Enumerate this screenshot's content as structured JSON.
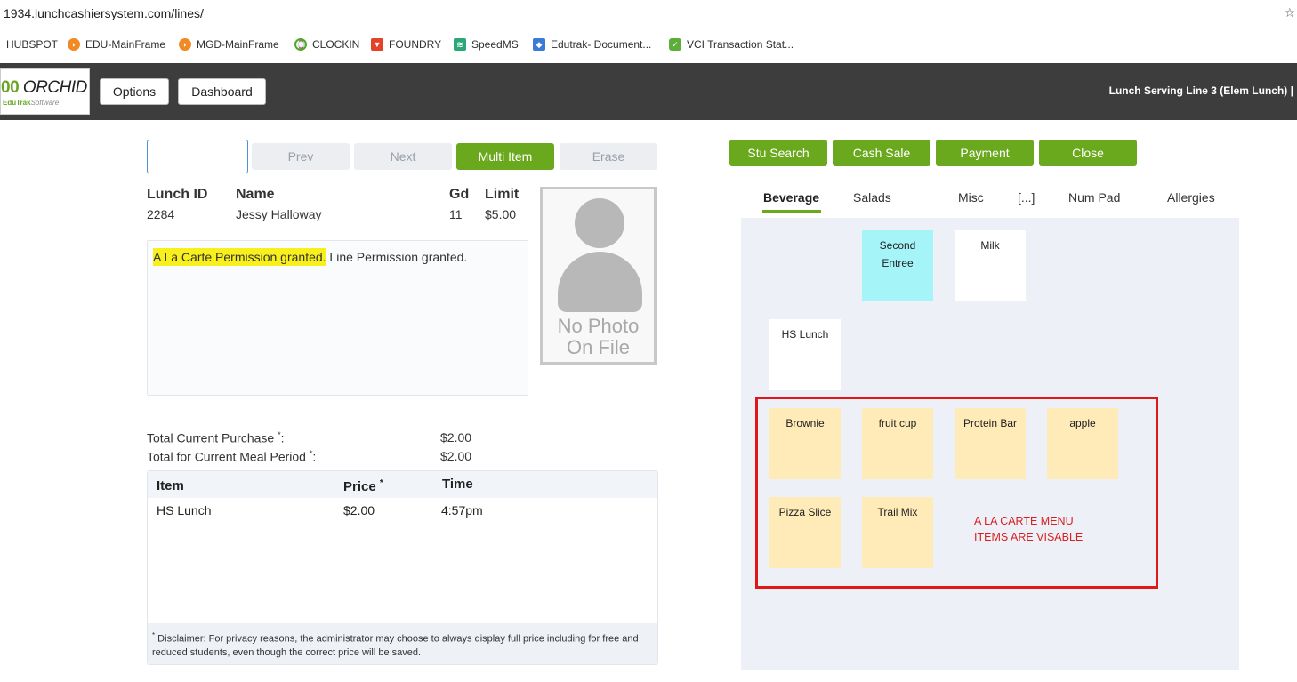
{
  "browser": {
    "url": "1934.lunchcashiersystem.com/lines/",
    "bookmarks": [
      {
        "label": "HUBSPOT",
        "icon": "hubspot-icon"
      },
      {
        "label": "EDU-MainFrame",
        "icon": "mainframe-icon"
      },
      {
        "label": "MGD-MainFrame",
        "icon": "mainframe-icon"
      },
      {
        "label": "CLOCKIN",
        "icon": "clock-icon"
      },
      {
        "label": "FOUNDRY",
        "icon": "gitlab-icon"
      },
      {
        "label": "SpeedMS",
        "icon": "speedms-icon"
      },
      {
        "label": "Edutrak- Document...",
        "icon": "docs-icon"
      },
      {
        "label": "VCI Transaction Stat...",
        "icon": "vci-icon"
      }
    ]
  },
  "header": {
    "logo_text": "ORCHID",
    "logo_prefix": "00",
    "logo_sub_brand": "EduTrak",
    "logo_sub_software": "Software",
    "options_label": "Options",
    "dashboard_label": "Dashboard",
    "line_title": "Lunch Serving Line 3 (Elem Lunch) |"
  },
  "controls": {
    "lunch_input_value": "",
    "prev_label": "Prev",
    "next_label": "Next",
    "multi_item_label": "Multi Item",
    "erase_label": "Erase"
  },
  "student": {
    "lunch_id_header": "Lunch ID",
    "name_header": "Name",
    "grade_header": "Gd",
    "limit_header": "Limit",
    "lunch_id": "2284",
    "name": "Jessy Halloway",
    "grade": "11",
    "limit": "$5.00",
    "photo_line1": "No Photo",
    "photo_line2": "On File"
  },
  "messages": {
    "highlighted": "A La Carte Permission granted.",
    "rest": " Line Permission granted."
  },
  "totals": {
    "current_purchase_label": "Total Current Purchase",
    "current_purchase_value": "$2.00",
    "meal_period_label": "Total for Current Meal Period",
    "meal_period_value": "$2.00",
    "asterisk": "*",
    "colon": ":"
  },
  "items_table": {
    "columns": [
      "Item",
      "Price",
      "Time"
    ],
    "price_asterisk": "*",
    "rows": [
      {
        "item": "HS Lunch",
        "price": "$2.00",
        "time": "4:57pm"
      }
    ],
    "disclaimer_asterisk": "*",
    "disclaimer": " Disclaimer: For privacy reasons, the administrator may choose to always display full price including for free and reduced students, even though the correct price will be saved."
  },
  "actions": {
    "stu_search_label": "Stu Search",
    "cash_sale_label": "Cash Sale",
    "payment_label": "Payment",
    "close_label": "Close"
  },
  "tabs": [
    "Beverage",
    "Salads",
    "Misc",
    "[...]",
    "Num Pad",
    "Allergies"
  ],
  "menu_tiles": {
    "second_entree_line1": "Second",
    "second_entree_line2": "Entree",
    "milk": "Milk",
    "hs_lunch": "HS Lunch",
    "brownie": "Brownie",
    "fruit_cup": "fruit cup",
    "protein_bar": "Protein Bar",
    "apple": "apple",
    "pizza_slice": "Pizza Slice",
    "trail_mix": "Trail Mix"
  },
  "annotation": {
    "line1": "A LA CARTE MENU",
    "line2": "ITEMS ARE VISABLE",
    "color": "#e01818"
  },
  "colors": {
    "accent_green": "#6aa81e",
    "header_bg": "#3d3d3d",
    "tile_cyan": "#a4f4f8",
    "tile_yellow": "#ffebb8",
    "highlight": "#f7f01c"
  }
}
